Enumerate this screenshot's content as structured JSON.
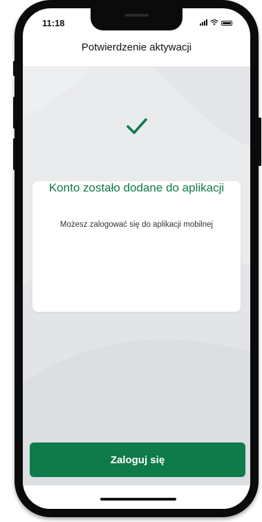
{
  "status_bar": {
    "time": "11:18",
    "icons": [
      "signal-icon",
      "wifi-icon",
      "battery-icon"
    ]
  },
  "header": {
    "title": "Potwierdzenie aktywacji"
  },
  "card": {
    "icon": "checkmark-icon",
    "title": "Konto zostało dodane do aplikacji",
    "subtitle": "Możesz zalogować się do aplikacji mobilnej"
  },
  "actions": {
    "login_label": "Zaloguj się"
  },
  "colors": {
    "accent": "#0f7a4a",
    "background": "#e9ebed"
  }
}
